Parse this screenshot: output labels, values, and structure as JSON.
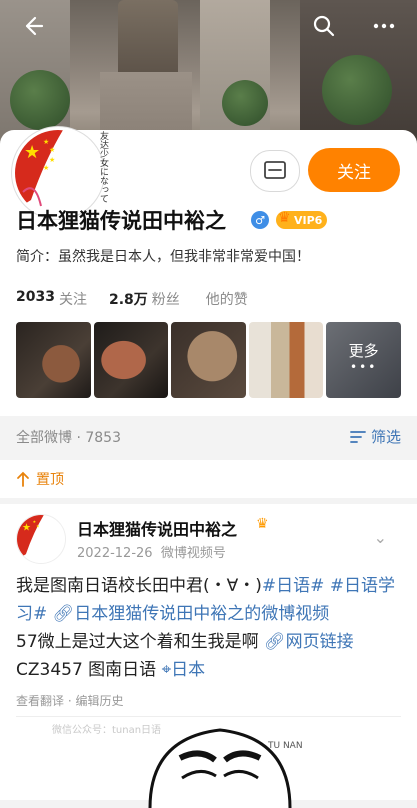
{
  "header": {
    "back_icon": "back-arrow-icon",
    "search_icon": "search-icon",
    "more_icon": "more-dots-icon"
  },
  "profile": {
    "name": "日本狸猫传说田中裕之",
    "vip_label": "VIP6",
    "bio": "简介：虽然我是日本人，但我非常非常爱中国！",
    "follow_label": "关注",
    "stats": [
      {
        "num": "2033",
        "label": "关注"
      },
      {
        "num": "2.8万",
        "label": "粉丝"
      },
      {
        "num": "",
        "label": "他的赞"
      }
    ],
    "photos_more": "更多",
    "avatar_text": "友达少女になって"
  },
  "feed": {
    "all_label": "全部微博 · 7853",
    "filter_label": "筛选",
    "pinned_label": "置顶"
  },
  "post": {
    "author": "日本狸猫传说田中裕之",
    "date": "2022-12-26",
    "source": "微博视频号",
    "text_plain_1": "我是图南日语校长田中君(・∀・)",
    "tag_1": "#日语#",
    "tag_2": "#日语学习#",
    "link_video": "日本狸猫传说田中裕之的微博视频",
    "text_plain_2": "57微上是过大这个着和生我是啊",
    "link_web": "网页链接",
    "text_plain_3": "CZ3457 图南日语",
    "location": "日本",
    "translate_label": "查看翻译",
    "edit_history_label": "编辑历史",
    "watermark": "微信公众号：tunan日语",
    "logo_text": "TU NAN"
  },
  "colors": {
    "accent_orange": "#ff8200",
    "link_blue": "#3f76b6",
    "pin_orange": "#e8830c"
  }
}
